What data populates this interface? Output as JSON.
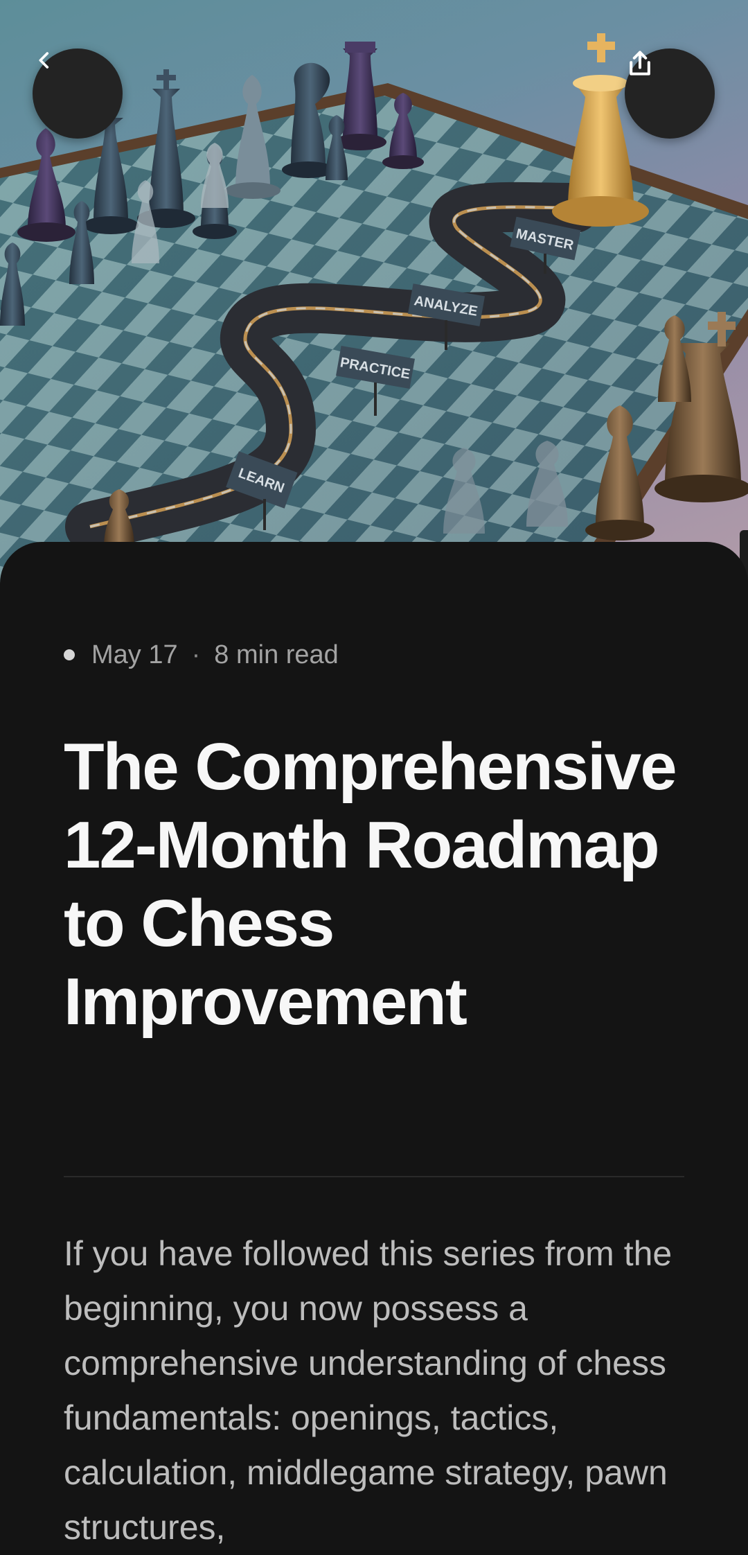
{
  "hero": {
    "signs": [
      "LEARN",
      "PRACTICE",
      "ANALYZE",
      "MASTER"
    ]
  },
  "nav": {
    "back_icon": "chevron-left-icon",
    "share_icon": "share-icon"
  },
  "article": {
    "date": "May 17",
    "separator": "·",
    "read_time": "8 min read",
    "title": "The Comprehensive 12-Month Roadmap to Chess Improvement",
    "body": "If you have followed this series from the beginning, you now possess a comprehensive understanding of chess fundamentals: openings, tactics, calculation, middlegame strategy, pawn structures,"
  },
  "colors": {
    "background": "#141414",
    "title": "#f7f7f7",
    "body": "#bdbdbd",
    "meta": "#a3a3a3",
    "button": "#232323"
  }
}
